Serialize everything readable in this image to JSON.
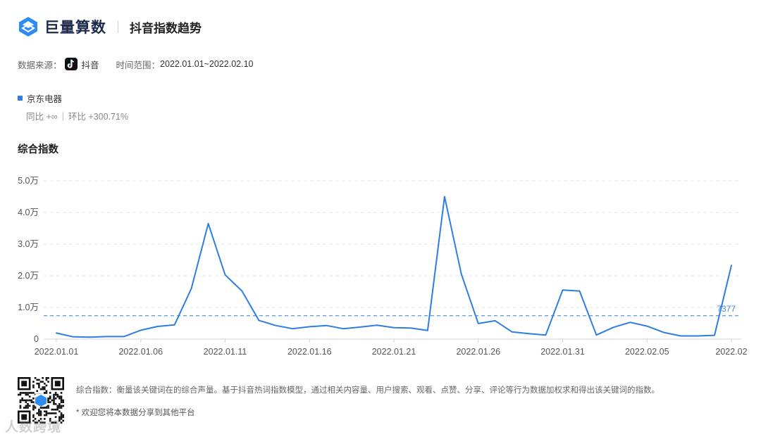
{
  "header": {
    "brand": "巨量算数",
    "title": "抖音指数趋势"
  },
  "meta": {
    "source_label": "数据来源：",
    "source_value": "抖音",
    "range_label": "时间范围：",
    "range_value": "2022.01.01~2022.02.10"
  },
  "series_info": {
    "name": "京东电器",
    "yoy": "同比 +∞",
    "sep": "|",
    "mom": "环比 +300.71%"
  },
  "section": {
    "title": "综合指数"
  },
  "chart_data": {
    "type": "line",
    "title": "",
    "xlabel": "",
    "ylabel": "",
    "y_ticks": [
      "0",
      "1.0万",
      "2.0万",
      "3.0万",
      "4.0万",
      "5.0万"
    ],
    "ylim": [
      0,
      50000
    ],
    "x_tick_labels": [
      "2022.01.01",
      "2022.01.06",
      "2022.01.11",
      "2022.01.16",
      "2022.01.21",
      "2022.01.26",
      "2022.01.31",
      "2022.02.05",
      "2022.02"
    ],
    "x_tick_indices": [
      0,
      5,
      10,
      15,
      20,
      25,
      30,
      35,
      40
    ],
    "x": [
      "2022.01.01",
      "2022.01.02",
      "2022.01.03",
      "2022.01.04",
      "2022.01.05",
      "2022.01.06",
      "2022.01.07",
      "2022.01.08",
      "2022.01.09",
      "2022.01.10",
      "2022.01.11",
      "2022.01.12",
      "2022.01.13",
      "2022.01.14",
      "2022.01.15",
      "2022.01.16",
      "2022.01.17",
      "2022.01.18",
      "2022.01.19",
      "2022.01.20",
      "2022.01.21",
      "2022.01.22",
      "2022.01.23",
      "2022.01.24",
      "2022.01.25",
      "2022.01.26",
      "2022.01.27",
      "2022.01.28",
      "2022.01.29",
      "2022.01.30",
      "2022.01.31",
      "2022.02.01",
      "2022.02.02",
      "2022.02.03",
      "2022.02.04",
      "2022.02.05",
      "2022.02.06",
      "2022.02.07",
      "2022.02.08",
      "2022.02.09",
      "2022.02.10"
    ],
    "series": [
      {
        "values": [
          1900,
          700,
          600,
          800,
          800,
          2800,
          4000,
          4500,
          16000,
          36500,
          20300,
          15200,
          5900,
          4300,
          3300,
          3900,
          4300,
          3300,
          3800,
          4400,
          3600,
          3500,
          2700,
          45000,
          20500,
          4900,
          5800,
          2300,
          1700,
          1300,
          15500,
          15200,
          1300,
          3700,
          5300,
          4100,
          2100,
          1000,
          1000,
          1200,
          23300
        ],
        "color": "#2f7de1"
      }
    ],
    "average": {
      "value": 7377,
      "label": "7377"
    },
    "grid": true
  },
  "footer": {
    "description": "综合指数：衡量该关键词在的综合声量。基于抖音热词指数模型，通过相关内容量、用户搜索、观看、点赞、分享、评论等行为数据加权求和得出该关键词的指数。",
    "note": "* 欢迎您将本数据分享到其他平台",
    "watermark": "人数跨境"
  }
}
